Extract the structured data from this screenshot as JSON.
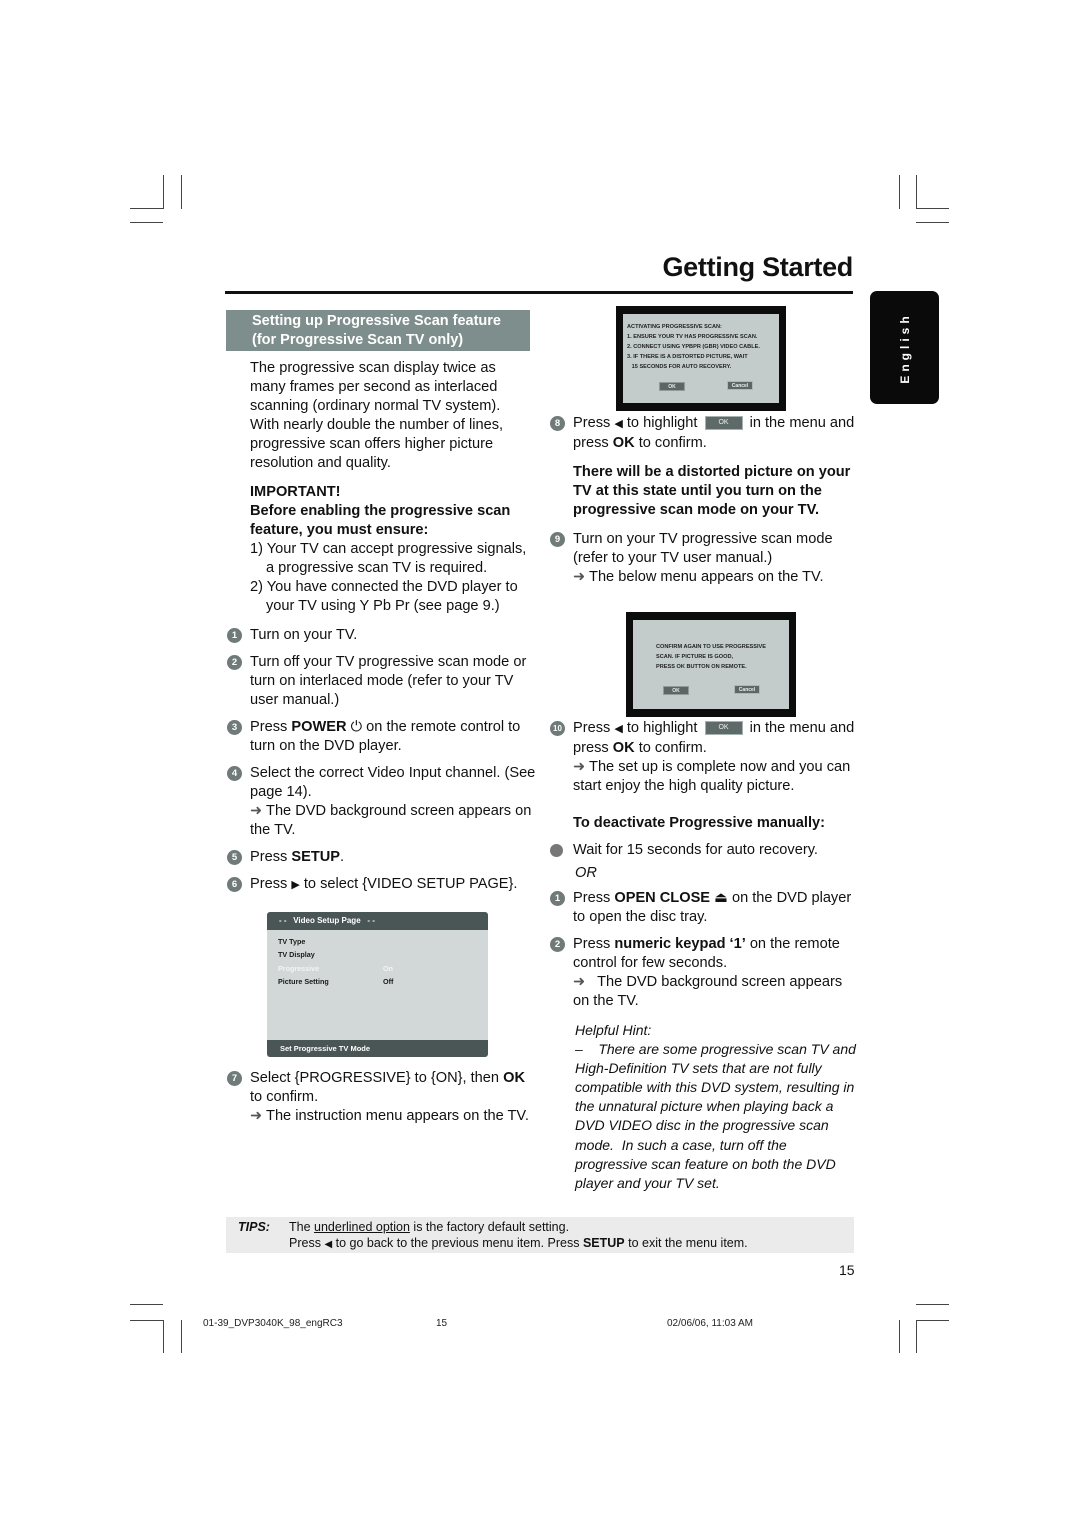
{
  "header": {
    "title": "Getting Started",
    "language_tab": "English"
  },
  "left": {
    "section_heading_line1": "Setting up Progressive Scan feature",
    "section_heading_line2": "(for Progressive Scan TV only)",
    "intro": [
      "The progressive scan display twice as",
      "many frames per second as interlaced",
      "scanning (ordinary normal TV system).",
      "With nearly double the number of lines,",
      "progressive scan offers higher picture",
      "resolution and quality."
    ],
    "important_label": "IMPORTANT!",
    "important_sub_line1": "Before enabling the progressive scan",
    "important_sub_line2": "feature, you must ensure:",
    "requirements": [
      "1) Your TV can accept progressive signals, a progressive scan TV is required.",
      "2) You have connected the DVD player to your TV using Y Pb Pr (see page 9.)"
    ],
    "steps": [
      {
        "num": "1",
        "text": "Turn on your TV."
      },
      {
        "num": "2",
        "text": "Turn off your TV progressive scan mode or turn on interlaced mode (refer to your TV user manual.)"
      },
      {
        "num": "3",
        "pre": "Press ",
        "bold": "POWER",
        "icon": "⏻",
        "post": " on the remote control to turn on the DVD player."
      },
      {
        "num": "4",
        "text": "Select the correct Video Input channel. (See page 14).",
        "result": "The DVD background screen appears on the TV."
      },
      {
        "num": "5",
        "pre": "Press ",
        "bold": "SETUP",
        "post": "."
      },
      {
        "num": "6",
        "pre": "Press ",
        "icon": "▶",
        "post": " to select {VIDEO SETUP PAGE}."
      },
      {
        "num": "7",
        "pre": "Select {PROGRESSIVE} to {ON}, then ",
        "bold": "OK",
        "post": " to confirm.",
        "result": "The instruction menu appears on the TV."
      }
    ],
    "setup_menu": {
      "header": "- -   Video Setup Page   - -",
      "rows": [
        {
          "label": "TV Type",
          "value": ""
        },
        {
          "label": "TV Display",
          "value": ""
        },
        {
          "label": "Progressive",
          "value": "On",
          "highlighted": true
        },
        {
          "label": "Picture Setting",
          "value": "Off"
        }
      ],
      "footer": "Set Progressive TV Mode"
    }
  },
  "right": {
    "dialog1": {
      "lines": [
        "ACTIVATING PROGRESSIVE SCAN:",
        "1. ENSURE YOUR TV HAS PROGRESSIVE SCAN.",
        "2. CONNECT USING YPBPR (GBR) VIDEO CABLE.",
        "3. IF THERE IS A DISTORTED PICTURE, WAIT",
        "   15 SECONDS FOR AUTO RECOVERY."
      ],
      "ok": "OK",
      "cancel": "Cancel"
    },
    "step8": {
      "num": "8",
      "pre": "Press ",
      "icon": "◀",
      "mid": " to highlight ",
      "ok_chip": "OK",
      "post": " in the menu and press ",
      "bold": "OK",
      "end": " to confirm."
    },
    "warning": "There will be a distorted picture on your TV at this state until you turn on the progressive scan mode on your TV.",
    "step9": {
      "num": "9",
      "text": "Turn on your TV progressive scan mode (refer to your TV user manual.)",
      "result": "The below menu appears on the TV."
    },
    "dialog2": {
      "lines": [
        "CONFIRM AGAIN TO USE PROGRESSIVE",
        "SCAN. IF PICTURE IS GOOD,",
        "PRESS OK BUTTON ON REMOTE."
      ],
      "ok": "OK",
      "cancel": "Cancel"
    },
    "step10": {
      "num": "10",
      "pre": "Press ",
      "icon": "◀",
      "mid": " to highlight ",
      "ok_chip": "OK",
      "post": " in the menu and press ",
      "bold": "OK",
      "end": " to confirm.",
      "result": "The set up is complete now and you can start enjoy the high quality picture."
    },
    "deactivate_heading": "To deactivate Progressive manually:",
    "deactivate_bullet": "Wait for 15 seconds for auto recovery.",
    "or_text": "OR",
    "deact_step1": {
      "num": "1",
      "pre": "Press ",
      "bold": "OPEN CLOSE",
      "icon": "⏏",
      "post": " on the DVD player to open the disc tray."
    },
    "deact_step2": {
      "num": "2",
      "pre": "Press ",
      "bold": "numeric keypad ‘1’",
      "post": " on the remote control for few seconds.",
      "result": "The DVD background screen appears on the TV."
    },
    "hint_title": "Helpful Hint:",
    "hint_text": "–    There are some progressive scan TV and High-Definition TV sets that are not fully compatible with this DVD system, resulting in the unnatural picture when playing back a DVD VIDEO disc in the progressive scan mode.  In such a case, turn off the progressive scan feature on both the DVD player and your TV set."
  },
  "tips": {
    "label": "TIPS:",
    "line1_pre": "The ",
    "line1_underlined": "underlined option",
    "line1_post": " is the factory default setting.",
    "line2_pre": "Press ",
    "line2_icon": "◀",
    "line2_mid": " to go back to the previous menu item. Press ",
    "line2_bold": "SETUP",
    "line2_post": " to exit the menu item."
  },
  "page_number": "15",
  "print_footer": {
    "file": "01-39_DVP3040K_98_engRC3",
    "page": "15",
    "datetime": "02/06/06, 11:03 AM"
  }
}
